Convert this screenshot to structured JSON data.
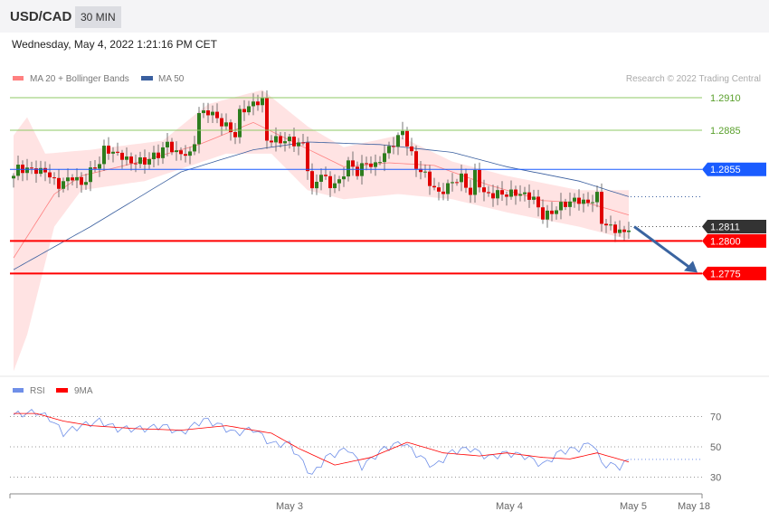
{
  "header": {
    "symbol": "USD/CAD",
    "timeframe": "30 MIN",
    "datetime": "Wednesday, May 4, 2022 1:21:16 PM CET"
  },
  "legend": {
    "ma20": "MA 20 + Bollinger Bands",
    "ma50": "MA 50",
    "rsi": "RSI",
    "rsi_ma": "9MA",
    "copyright": "Research © 2022 Trading Central"
  },
  "colors": {
    "ma20": "#ff8080",
    "ma50": "#3a5f9f",
    "band": "#ffe3e3",
    "up": "#2e7d1e",
    "down": "#e00000",
    "resistance": "#8fc866",
    "pivot": "#1a5cff",
    "support": "#ff0000",
    "last": "#333333",
    "rsi": "#6f8fe8",
    "rsi_ma": "#ff0000"
  },
  "chart_data": [
    {
      "type": "candlestick",
      "title": "USD/CAD 30 MIN",
      "ylim": [
        1.269,
        1.2925
      ],
      "levels": [
        {
          "label": "1.2910",
          "value": 1.291,
          "kind": "resistance"
        },
        {
          "label": "1.2885",
          "value": 1.2885,
          "kind": "resistance"
        },
        {
          "label": "1.2855",
          "value": 1.2855,
          "kind": "pivot"
        },
        {
          "label": "1.2811",
          "value": 1.2811,
          "kind": "last"
        },
        {
          "label": "1.2800",
          "value": 1.28,
          "kind": "support"
        },
        {
          "label": "1.2775",
          "value": 1.2775,
          "kind": "support"
        }
      ],
      "candle_count": 137,
      "close_keypoints": [
        [
          0,
          1.285
        ],
        [
          1,
          1.2856
        ],
        [
          7,
          1.2854
        ],
        [
          10,
          1.2843
        ],
        [
          13,
          1.285
        ],
        [
          15,
          1.2843
        ],
        [
          17,
          1.2853
        ],
        [
          19,
          1.286
        ],
        [
          20,
          1.287
        ],
        [
          23,
          1.2866
        ],
        [
          26,
          1.286
        ],
        [
          29,
          1.2861
        ],
        [
          32,
          1.2867
        ],
        [
          34,
          1.2875
        ],
        [
          36,
          1.2868
        ],
        [
          39,
          1.2867
        ],
        [
          40,
          1.2877
        ],
        [
          41,
          1.2898
        ],
        [
          43,
          1.29
        ],
        [
          46,
          1.2891
        ],
        [
          49,
          1.2881
        ],
        [
          50,
          1.2898
        ],
        [
          53,
          1.2905
        ],
        [
          55,
          1.2907
        ],
        [
          56,
          1.2877
        ],
        [
          57,
          1.2877
        ],
        [
          61,
          1.2877
        ],
        [
          64,
          1.2874
        ],
        [
          65,
          1.2857
        ],
        [
          66,
          1.2839
        ],
        [
          68,
          1.2853
        ],
        [
          70,
          1.2843
        ],
        [
          72,
          1.2846
        ],
        [
          74,
          1.286
        ],
        [
          76,
          1.2853
        ],
        [
          78,
          1.286
        ],
        [
          80,
          1.2857
        ],
        [
          82,
          1.2867
        ],
        [
          84,
          1.2874
        ],
        [
          86,
          1.2884
        ],
        [
          87,
          1.2874
        ],
        [
          89,
          1.2857
        ],
        [
          91,
          1.285
        ],
        [
          94,
          1.2836
        ],
        [
          96,
          1.2843
        ],
        [
          99,
          1.285
        ],
        [
          101,
          1.2836
        ],
        [
          102,
          1.2853
        ],
        [
          104,
          1.2836
        ],
        [
          106,
          1.2836
        ],
        [
          109,
          1.2836
        ],
        [
          112,
          1.2836
        ],
        [
          115,
          1.2832
        ],
        [
          117,
          1.2818
        ],
        [
          119,
          1.2822
        ],
        [
          122,
          1.2829
        ],
        [
          125,
          1.2832
        ],
        [
          127,
          1.2829
        ],
        [
          129,
          1.2836
        ],
        [
          130,
          1.2815
        ],
        [
          132,
          1.2811
        ],
        [
          135,
          1.2806
        ],
        [
          136,
          1.2808
        ]
      ],
      "ma50": [
        [
          0,
          1.2778
        ],
        [
          17,
          1.2811
        ],
        [
          37,
          1.2853
        ],
        [
          53,
          1.287
        ],
        [
          65,
          1.2876
        ],
        [
          81,
          1.2874
        ],
        [
          97,
          1.2868
        ],
        [
          109,
          1.2857
        ],
        [
          125,
          1.2846
        ],
        [
          136,
          1.2834
        ]
      ],
      "ma20": [
        [
          0,
          1.2787
        ],
        [
          9,
          1.2836
        ],
        [
          15,
          1.285
        ],
        [
          27,
          1.286
        ],
        [
          41,
          1.2874
        ],
        [
          53,
          1.2891
        ],
        [
          63,
          1.2874
        ],
        [
          73,
          1.2857
        ],
        [
          83,
          1.286
        ],
        [
          93,
          1.2858
        ],
        [
          105,
          1.2843
        ],
        [
          117,
          1.2831
        ],
        [
          127,
          1.2829
        ],
        [
          136,
          1.282
        ]
      ],
      "bb_upper": [
        [
          0,
          1.2881
        ],
        [
          3,
          1.2895
        ],
        [
          7,
          1.2867
        ],
        [
          17,
          1.287
        ],
        [
          33,
          1.2877
        ],
        [
          43,
          1.2905
        ],
        [
          55,
          1.2916
        ],
        [
          65,
          1.2888
        ],
        [
          73,
          1.2872
        ],
        [
          85,
          1.2881
        ],
        [
          97,
          1.2861
        ],
        [
          109,
          1.285
        ],
        [
          125,
          1.2839
        ],
        [
          136,
          1.2839
        ]
      ],
      "bb_lower": [
        [
          0,
          1.27
        ],
        [
          3,
          1.2728
        ],
        [
          9,
          1.2811
        ],
        [
          15,
          1.2839
        ],
        [
          29,
          1.2846
        ],
        [
          47,
          1.2867
        ],
        [
          57,
          1.2867
        ],
        [
          65,
          1.2839
        ],
        [
          73,
          1.2832
        ],
        [
          85,
          1.2836
        ],
        [
          97,
          1.2832
        ],
        [
          109,
          1.2822
        ],
        [
          125,
          1.2811
        ],
        [
          136,
          1.2801
        ]
      ],
      "x_ticks": [
        "May 3",
        "May 4",
        "May 5",
        "May 18"
      ],
      "forecast": {
        "from": 1.2811,
        "to": 1.2775
      }
    },
    {
      "type": "line",
      "title": "RSI",
      "ylim": [
        20,
        80
      ],
      "y_ticks": [
        "70",
        "50",
        "30"
      ],
      "y_tick_values": [
        70,
        50,
        30
      ],
      "rsi": [
        [
          0,
          71
        ],
        [
          5,
          73
        ],
        [
          8,
          69
        ],
        [
          11,
          59
        ],
        [
          15,
          64
        ],
        [
          19,
          67
        ],
        [
          23,
          62
        ],
        [
          29,
          62
        ],
        [
          33,
          64
        ],
        [
          37,
          59
        ],
        [
          42,
          68
        ],
        [
          45,
          65
        ],
        [
          49,
          59
        ],
        [
          53,
          62
        ],
        [
          57,
          52
        ],
        [
          61,
          52
        ],
        [
          66,
          31
        ],
        [
          69,
          43
        ],
        [
          74,
          49
        ],
        [
          77,
          37
        ],
        [
          82,
          49
        ],
        [
          86,
          53
        ],
        [
          90,
          43
        ],
        [
          93,
          37
        ],
        [
          97,
          47
        ],
        [
          101,
          49
        ],
        [
          105,
          43
        ],
        [
          109,
          46
        ],
        [
          113,
          44
        ],
        [
          117,
          38
        ],
        [
          121,
          47
        ],
        [
          125,
          49
        ],
        [
          128,
          53
        ],
        [
          130,
          39
        ],
        [
          134,
          37
        ],
        [
          136,
          41
        ]
      ],
      "ma9": [
        [
          0,
          72
        ],
        [
          5,
          72
        ],
        [
          11,
          67
        ],
        [
          17,
          64
        ],
        [
          27,
          62
        ],
        [
          37,
          61
        ],
        [
          47,
          64
        ],
        [
          57,
          59
        ],
        [
          63,
          49
        ],
        [
          71,
          38
        ],
        [
          79,
          43
        ],
        [
          87,
          53
        ],
        [
          95,
          46
        ],
        [
          103,
          44
        ],
        [
          109,
          46
        ],
        [
          117,
          43
        ],
        [
          123,
          42
        ],
        [
          129,
          46
        ],
        [
          136,
          40
        ]
      ]
    }
  ]
}
